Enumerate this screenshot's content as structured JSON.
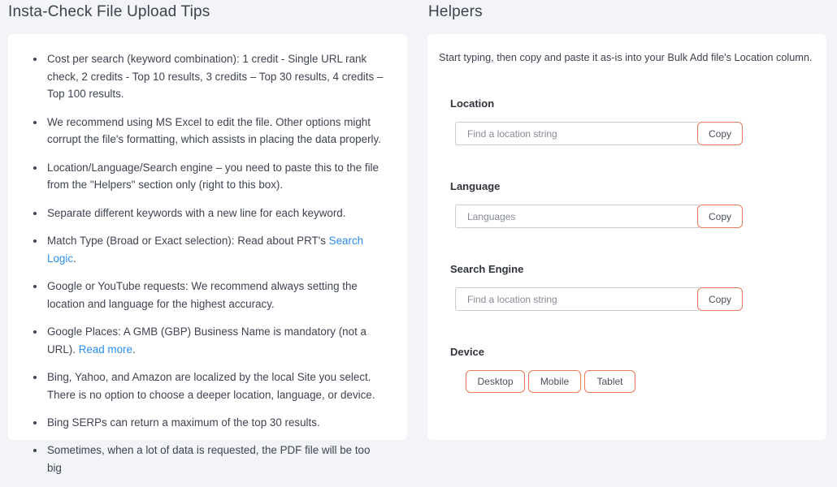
{
  "left": {
    "title": "Insta-Check File Upload Tips",
    "tips": [
      {
        "text": "Cost per search (keyword combination): 1 credit - Single URL rank check, 2 credits - Top 10 results, 3 credits – Top 30 results, 4 credits – Top 100 results."
      },
      {
        "text": "We recommend using MS Excel to edit the file. Other options might corrupt the file's formatting, which assists in placing the data properly."
      },
      {
        "text": "Location/Language/Search engine – you need to paste this to the file from the \"Helpers\" section only (right to this box)."
      },
      {
        "text": "Separate different keywords with a new line for each keyword."
      },
      {
        "text": "Match Type (Broad or Exact selection): Read about PRT's ",
        "link": "Search Logic",
        "after": "."
      },
      {
        "text": "Google or YouTube requests: We recommend always setting the location and language for the highest accuracy."
      },
      {
        "text": "Google Places: A GMB (GBP) Business Name is mandatory (not a URL). ",
        "link": "Read more",
        "after": "."
      },
      {
        "text": "Bing, Yahoo, and Amazon are localized by the local Site you select. There is no option to choose a deeper location, language, or device."
      },
      {
        "text": "Bing SERPs can return a maximum of the top 30 results."
      },
      {
        "text": "Sometimes, when a lot of data is requested, the PDF file will be too big"
      }
    ]
  },
  "right": {
    "title": "Helpers",
    "intro": "Start typing, then copy and paste it as-is into your Bulk Add file's Location column.",
    "location": {
      "label": "Location",
      "placeholder": "Find a location string",
      "copy": "Copy"
    },
    "language": {
      "label": "Language",
      "placeholder": "Languages",
      "copy": "Copy"
    },
    "engine": {
      "label": "Search Engine",
      "placeholder": "Find a location string",
      "copy": "Copy"
    },
    "device": {
      "label": "Device",
      "options": [
        "Desktop",
        "Mobile",
        "Tablet"
      ]
    }
  },
  "colors": {
    "accent_border": "#e8795a",
    "link": "#2b8ef0",
    "background": "#f3f4f8"
  }
}
